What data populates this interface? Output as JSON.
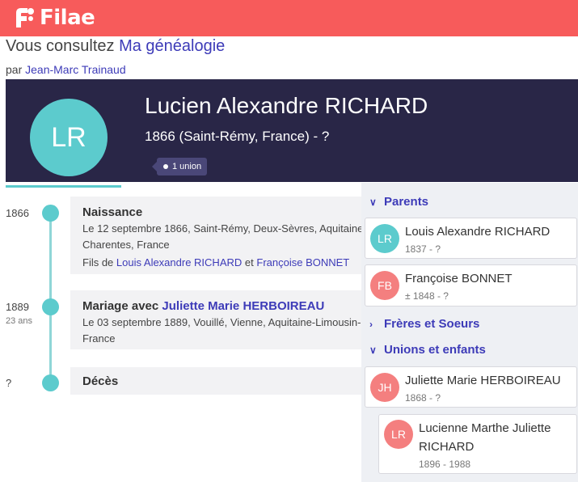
{
  "brand": {
    "name": "Filae",
    "color": "#f75b5b"
  },
  "header": {
    "consult_prefix": "Vous consultez",
    "tree_link": "Ma généalogie",
    "author_prefix": "par",
    "author_link": "Jean-Marc Trainaud"
  },
  "person": {
    "initials": "LR",
    "name": "Lucien Alexandre RICHARD",
    "dates": "1866 (Saint-Rémy, France) - ?",
    "union_badge": "1 union"
  },
  "timeline": {
    "events": [
      {
        "year": "1866",
        "age": "",
        "title": "Naissance",
        "title_link": "",
        "line1": "Le 12 septembre 1866, Saint-Rémy, Deux-Sèvres, Aquitaine-",
        "line2": "Charentes, France",
        "child_prefix": "Fils de",
        "father": "Louis Alexandre RICHARD",
        "and": "et",
        "mother": "Françoise BONNET"
      },
      {
        "year": "1889",
        "age": "23 ans",
        "title": "Mariage avec",
        "title_link": "Juliette Marie HERBOIREAU",
        "line1": "Le 03 septembre 1889, Vouillé, Vienne, Aquitaine-Limousin-",
        "line2": "France"
      },
      {
        "year": "?",
        "age": "",
        "title": "Décès"
      }
    ]
  },
  "sidebar": {
    "parents_label": "Parents",
    "siblings_label": "Frères et Soeurs",
    "unions_label": "Unions et enfants",
    "parents": [
      {
        "initials": "LR",
        "name": "Louis Alexandre RICHARD",
        "dates": "1837 - ?",
        "color": "#5ccbcd"
      },
      {
        "initials": "FB",
        "name": "Françoise BONNET",
        "dates": "± 1848 - ?",
        "color": "#f47f7f"
      }
    ],
    "spouse": {
      "initials": "JH",
      "name": "Juliette Marie HERBOIREAU",
      "dates": "1868 - ?",
      "color": "#f47f7f"
    },
    "child": {
      "initials": "LR",
      "name_line1": "Lucienne Marthe Juliette",
      "name_line2": "RICHARD",
      "dates": "1896 - 1988",
      "color": "#f47f7f"
    }
  },
  "colors": {
    "accent": "#3d3bb8",
    "teal": "#5ccbcd",
    "hero_bg": "#292647",
    "female": "#f47f7f"
  }
}
